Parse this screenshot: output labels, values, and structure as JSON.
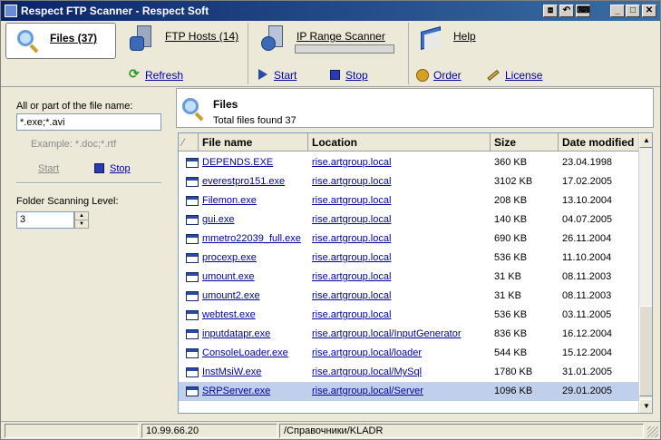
{
  "window": {
    "title": "Respect FTP Scanner - Respect Soft",
    "controls": {
      "restore_alt": "⧈",
      "undo_alt": "↶",
      "keyboard_alt": "⌨",
      "minimize": "_",
      "maximize": "□",
      "close": "✕"
    }
  },
  "toolbar": {
    "files_tab": "Files (37)",
    "ftp_hosts": "FTP Hosts (14)",
    "ip_range_scanner": "IP Range Scanner",
    "ip_range_progress": 0,
    "help": "Help",
    "refresh": "Refresh",
    "start": "Start",
    "stop": "Stop",
    "order": "Order",
    "license": "License",
    "icons": {
      "files": "magnifier-icon",
      "ftp_hosts": "server-icon",
      "ip_range": "network-scan-icon",
      "help": "help-book-icon",
      "refresh": "refresh-icon",
      "start": "play-icon",
      "stop": "stop-icon",
      "order": "order-icon",
      "license": "license-pencil-icon"
    }
  },
  "search": {
    "file_name_label": "All or part of the file name:",
    "file_name_value": "*.exe;*.avi",
    "example": "Example: *.doc;*.rtf",
    "start": "Start",
    "stop": "Stop",
    "folder_level_label": "Folder Scanning Level:",
    "folder_level_value": "3"
  },
  "files": {
    "title": "Files",
    "total": "Total files found 37",
    "sort_indicator": "⁄",
    "columns": [
      "File name",
      "Location",
      "Size",
      "Date modified"
    ],
    "rows": [
      {
        "name": "DEPENDS.EXE",
        "location": "rise.artgroup.local",
        "size": "360 KB",
        "date": "23.04.1998"
      },
      {
        "name": "everestpro151.exe",
        "location": "rise.artgroup.local",
        "size": "3102 KB",
        "date": "17.02.2005"
      },
      {
        "name": "Filemon.exe",
        "location": "rise.artgroup.local",
        "size": "208 KB",
        "date": "13.10.2004"
      },
      {
        "name": "gui.exe",
        "location": "rise.artgroup.local",
        "size": "140 KB",
        "date": "04.07.2005"
      },
      {
        "name": "mmetro22039_full.exe",
        "location": "rise.artgroup.local",
        "size": "690 KB",
        "date": "26.11.2004"
      },
      {
        "name": "procexp.exe",
        "location": "rise.artgroup.local",
        "size": "536 KB",
        "date": "11.10.2004"
      },
      {
        "name": "umount.exe",
        "location": "rise.artgroup.local",
        "size": "31 KB",
        "date": "08.11.2003"
      },
      {
        "name": "umount2.exe",
        "location": "rise.artgroup.local",
        "size": "31 KB",
        "date": "08.11.2003"
      },
      {
        "name": "webtest.exe",
        "location": "rise.artgroup.local",
        "size": "536 KB",
        "date": "03.11.2005"
      },
      {
        "name": "inputdatapr.exe",
        "location": "rise.artgroup.local/InputGenerator",
        "size": "836 KB",
        "date": "16.12.2004"
      },
      {
        "name": "ConsoleLoader.exe",
        "location": "rise.artgroup.local/loader",
        "size": "544 KB",
        "date": "15.12.2004"
      },
      {
        "name": "InstMsiW.exe",
        "location": "rise.artgroup.local/MySql",
        "size": "1780 KB",
        "date": "31.01.2005"
      },
      {
        "name": "SRPServer.exe",
        "location": "rise.artgroup.local/Server",
        "size": "1096 KB",
        "date": "29.01.2005",
        "selected": true
      }
    ]
  },
  "status": {
    "left": "",
    "ip": "10.99.66.20",
    "path": "/Справочники/KLADR"
  }
}
